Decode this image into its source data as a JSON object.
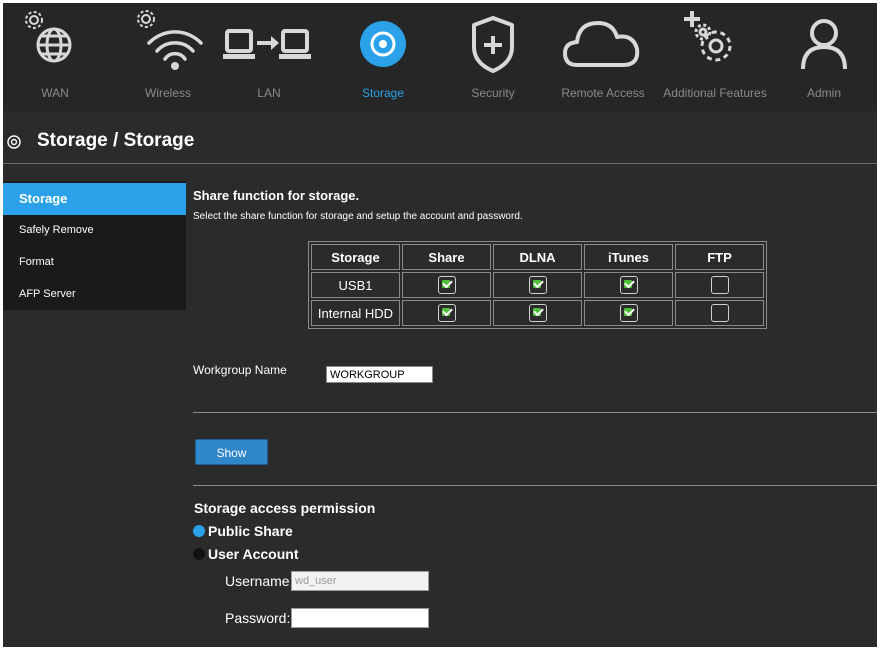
{
  "nav": {
    "items": [
      {
        "label": "WAN",
        "icon": "globe-gear-icon",
        "active": false
      },
      {
        "label": "Wireless",
        "icon": "wifi-gear-icon",
        "active": false
      },
      {
        "label": "LAN",
        "icon": "lan-computers-icon",
        "active": false
      },
      {
        "label": "Storage",
        "icon": "disc-icon",
        "active": true
      },
      {
        "label": "Security",
        "icon": "shield-icon",
        "active": false
      },
      {
        "label": "Remote Access",
        "icon": "cloud-icon",
        "active": false
      },
      {
        "label": "Additional Features",
        "icon": "gears-plus-icon",
        "active": false
      },
      {
        "label": "Admin",
        "icon": "user-icon",
        "active": false
      }
    ]
  },
  "header": {
    "title": "Storage / Storage",
    "icon": "disc-icon"
  },
  "sidebar": {
    "items": [
      {
        "label": "Storage",
        "active": true
      },
      {
        "label": "Safely Remove",
        "active": false
      },
      {
        "label": "Format",
        "active": false
      },
      {
        "label": "AFP Server",
        "active": false
      }
    ]
  },
  "main": {
    "title": "Share function for storage.",
    "description": "Select the share function for storage and setup the account and password.",
    "table": {
      "headers": [
        "Storage",
        "Share",
        "DLNA",
        "iTunes",
        "FTP"
      ],
      "rows": [
        {
          "name": "USB1",
          "share": true,
          "dlna": true,
          "itunes": true,
          "ftp": false
        },
        {
          "name": "Internal HDD",
          "share": true,
          "dlna": true,
          "itunes": true,
          "ftp": false
        }
      ]
    },
    "workgroup": {
      "label": "Workgroup Name",
      "value": "WORKGROUP"
    },
    "show_button": "Show",
    "permission": {
      "title": "Storage access permission",
      "options": [
        {
          "label": "Public Share",
          "selected": true
        },
        {
          "label": "User Account",
          "selected": false
        }
      ],
      "username_label": "Username:",
      "username_value": "wd_user",
      "password_label": "Password:",
      "password_value": ""
    }
  },
  "colors": {
    "accent": "#2aa1e8",
    "background": "#2b2b2b",
    "check": "#4fbf3a",
    "button": "#2f86c9"
  }
}
